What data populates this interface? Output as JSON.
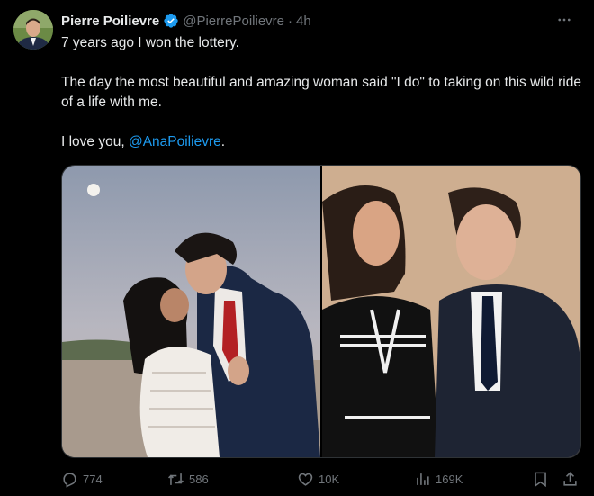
{
  "author": {
    "name": "Pierre Poilievre",
    "handle": "@PierrePoilievre",
    "separator": "·",
    "time": "4h",
    "verified_color": "#1d9bf0"
  },
  "tweet": {
    "line1": "7 years ago I won the lottery.",
    "line2": "The day the most beautiful and amazing woman said \"I do\" to taking on this wild ride of a life with me.",
    "line3_prefix": "I love you, ",
    "mention": "@AnaPoilievre",
    "line3_suffix": "."
  },
  "actions": {
    "replies": "774",
    "reposts": "586",
    "likes": "10K",
    "views": "169K"
  },
  "icons": {
    "more": "more-icon",
    "reply": "reply-icon",
    "repost": "repost-icon",
    "like": "heart-icon",
    "views": "views-icon",
    "bookmark": "bookmark-icon",
    "share": "share-icon"
  },
  "colors": {
    "background": "#000000",
    "text": "#e7e9ea",
    "muted": "#71767b",
    "accent": "#1d9bf0"
  }
}
